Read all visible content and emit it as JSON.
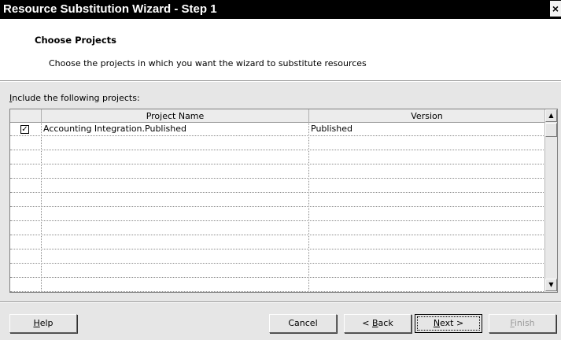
{
  "window": {
    "title": "Resource Substitution Wizard - Step 1",
    "close_glyph": "×"
  },
  "header": {
    "title": "Choose Projects",
    "subtitle": "Choose the projects in which you want the wizard to substitute resources"
  },
  "include_label_prefix": "I",
  "include_label_rest": "nclude the following projects:",
  "grid": {
    "columns": [
      "",
      "Project Name",
      "Version"
    ],
    "rows": [
      {
        "checked": true,
        "check_glyph": "✓",
        "project": "Accounting Integration.Published",
        "version": "Published"
      }
    ],
    "empty_rows": 11
  },
  "scrollbar": {
    "up_glyph": "▲",
    "down_glyph": "▼"
  },
  "buttons": {
    "help": {
      "accel": "H",
      "rest": "elp"
    },
    "cancel": {
      "label": "Cancel"
    },
    "back": {
      "pre": "< ",
      "accel": "B",
      "rest": "ack"
    },
    "next": {
      "accel": "N",
      "rest": "ext >"
    },
    "finish": {
      "accel": "F",
      "rest": "inish",
      "disabled": true
    }
  }
}
